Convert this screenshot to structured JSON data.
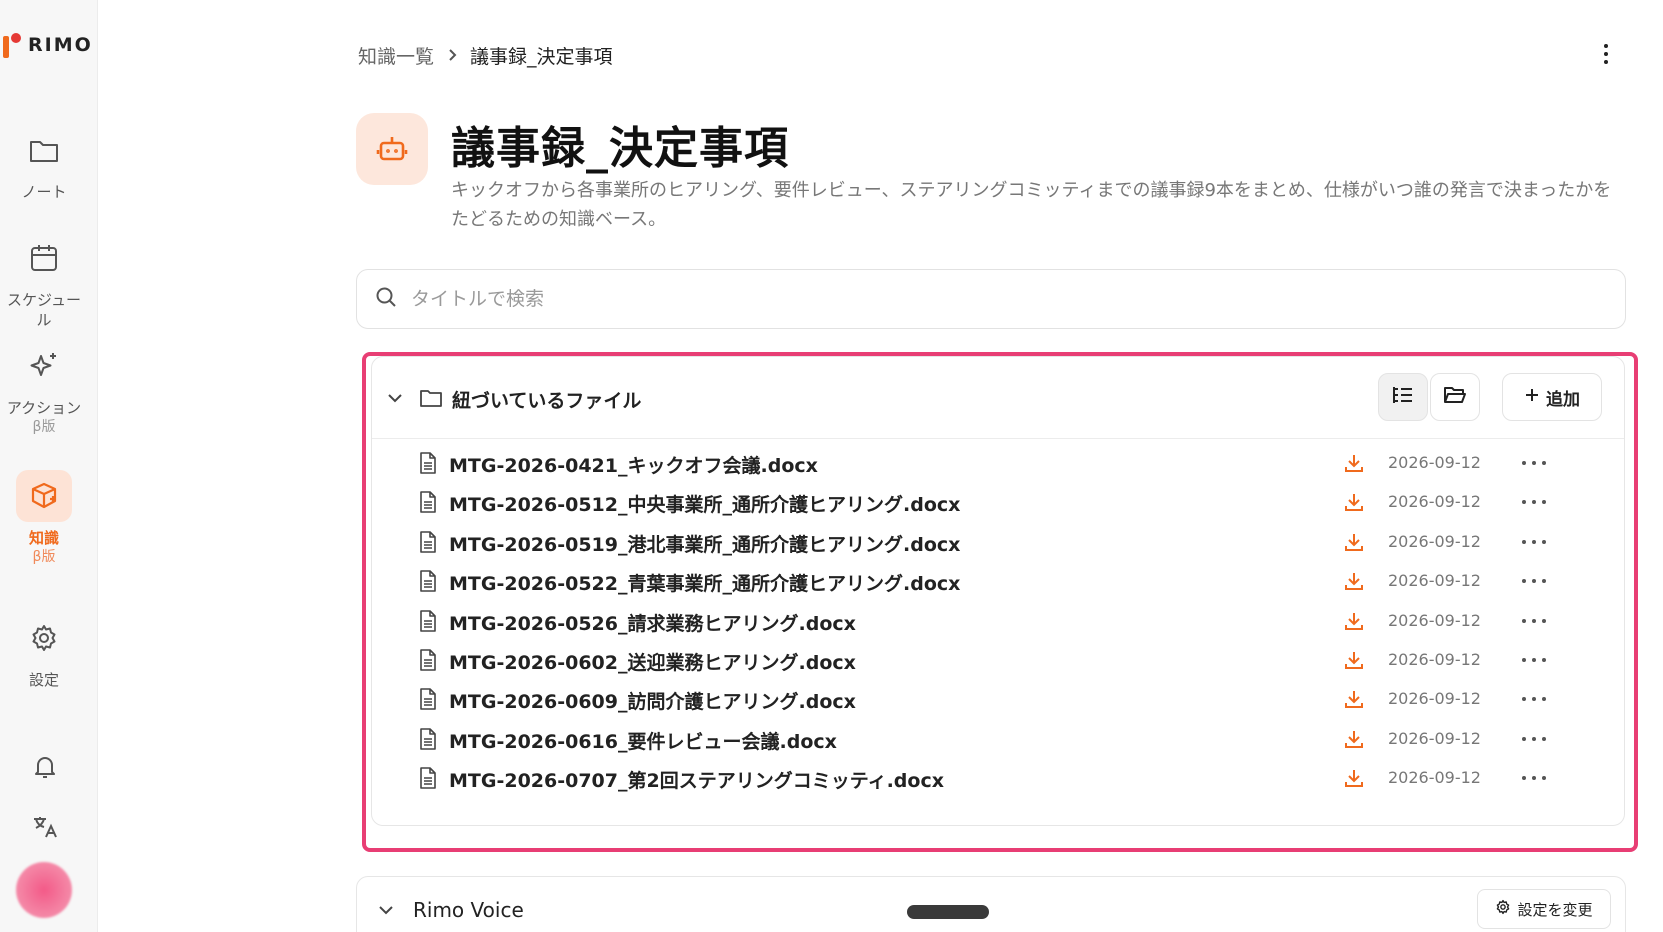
{
  "app": {
    "logo_text": "RIMO"
  },
  "sidebar": {
    "items": [
      {
        "label": "ノート",
        "sub": "",
        "icon": "folder-icon"
      },
      {
        "label": "スケジュール",
        "sub": "",
        "icon": "calendar-icon"
      },
      {
        "label": "アクション",
        "sub": "β版",
        "icon": "sparkles-icon"
      },
      {
        "label": "知識",
        "sub": "β版",
        "icon": "knowledge-box-icon",
        "active": true
      },
      {
        "label": "設定",
        "sub": "",
        "icon": "gear-icon"
      }
    ],
    "bottom_icons": [
      "bell-icon",
      "translate-icon"
    ],
    "accent_color": "#f06a1d"
  },
  "breadcrumb": {
    "parent": "知識一覧",
    "current": "議事録_決定事項"
  },
  "page": {
    "title": "議事録_決定事項",
    "description": "キックオフから各事業所のヒアリング、要件レビュー、ステアリングコミッティまでの議事録9本をまとめ、仕様がいつ誰の発言で決まったかをたどるための知識ベース。",
    "icon": "robot-icon"
  },
  "search": {
    "placeholder": "タイトルで検索",
    "value": ""
  },
  "files_section": {
    "title": "紐づいているファイル",
    "add_label": "追加",
    "files": [
      {
        "name": "MTG-2026-0421_キックオフ会議.docx",
        "date": "2026-09-12"
      },
      {
        "name": "MTG-2026-0512_中央事業所_通所介護ヒアリング.docx",
        "date": "2026-09-12"
      },
      {
        "name": "MTG-2026-0519_港北事業所_通所介護ヒアリング.docx",
        "date": "2026-09-12"
      },
      {
        "name": "MTG-2026-0522_青葉事業所_通所介護ヒアリング.docx",
        "date": "2026-09-12"
      },
      {
        "name": "MTG-2026-0526_請求業務ヒアリング.docx",
        "date": "2026-09-12"
      },
      {
        "name": "MTG-2026-0602_送迎業務ヒアリング.docx",
        "date": "2026-09-12"
      },
      {
        "name": "MTG-2026-0609_訪問介護ヒアリング.docx",
        "date": "2026-09-12"
      },
      {
        "name": "MTG-2026-0616_要件レビュー会議.docx",
        "date": "2026-09-12"
      },
      {
        "name": "MTG-2026-0707_第2回ステアリングコミッティ.docx",
        "date": "2026-09-12"
      }
    ]
  },
  "voice_section": {
    "title": "Rimo Voice",
    "settings_label": "設定を変更"
  },
  "colors": {
    "highlight": "#e83e74",
    "download": "#f06a1d"
  }
}
